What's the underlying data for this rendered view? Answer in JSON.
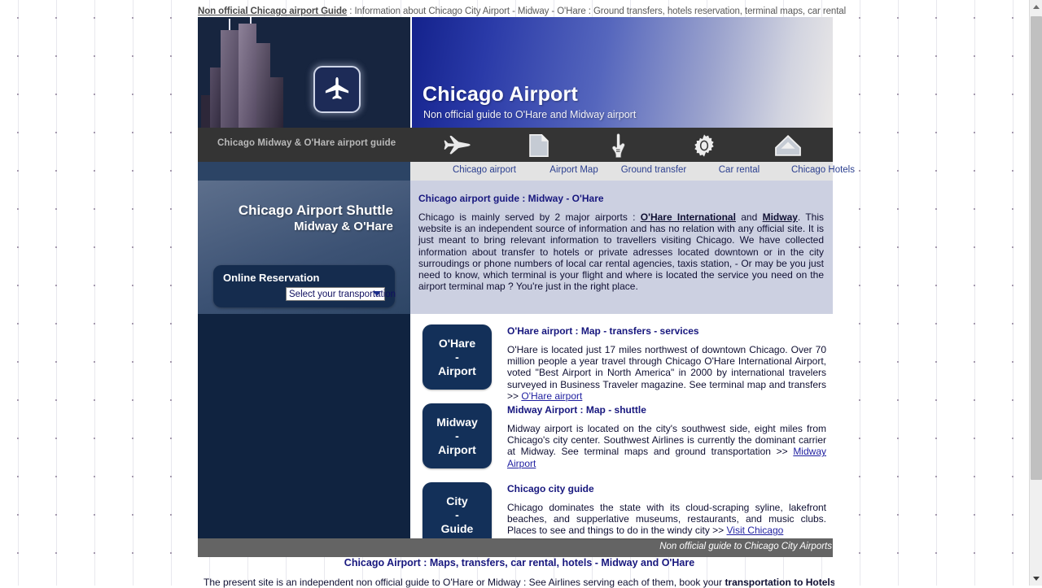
{
  "document": {
    "title_strong": "Non official Chicago airport Guide",
    "title_rest": " : Information about Chicago City Airport - Midway - O'Hare : Ground transfers, hotels reservation, terminal maps, car rental"
  },
  "banner": {
    "heading": "Chicago Airport",
    "subheading": "Non official guide to O'Hare and Midway airport",
    "photo_alt": "willis-tower-photo",
    "badge_icon": "airplane-icon"
  },
  "nav": {
    "tagline": "Chicago Midway & O'Hare airport guide",
    "items": [
      {
        "icon": "airplane-icon",
        "label": "Chicago airport"
      },
      {
        "icon": "document-icon",
        "label": "Airport Map"
      },
      {
        "icon": "pointing-hand-icon",
        "label": "Ground transfer"
      },
      {
        "icon": "gear-icon",
        "label": "Car rental"
      },
      {
        "icon": "house-icon",
        "label": "Chicago Hotels"
      }
    ]
  },
  "sidebar": {
    "heading": "Chicago Airport Shuttle",
    "subheading": "Midway & O'Hare",
    "reservation_title": "Online Reservation",
    "select_value": "Select your transportation",
    "select_options": [
      "Select your transportation"
    ]
  },
  "intro": {
    "title": "Chicago airport guide : Midway - O'Hare",
    "text_part1": "Chicago is mainly served by 2 major airports : ",
    "link1": "O'Hare International",
    "text_part2": " and ",
    "link2": "Midway",
    "text_part3": ". This website is an independent source of information and has no relation with any official site. It is just meant to bring relevant information to travellers visiting Chicago. We have collected information about transfer to hotels or private adresses located downtown or in the city surroudings or phone numbers of local car rental agencies, taxis station, - Or may be you just need to know, which terminal is your flight and where is located the service you need on the airport terminal map ? You're just in the right place."
  },
  "sections": [
    {
      "badge_line1": "O'Hare",
      "badge_line2": "-",
      "badge_line3": "Airport",
      "title": "O'Hare airport : Map - transfers - services",
      "body": "O'Hare is located just 17 miles northwest of downtown Chicago. Over 70 million people a year travel through Chicago O'Hare International Airport, voted \"Best Airport in North America\" in 2000 by international travelers surveyed in Business Traveler magazine. See terminal map and transfers >> ",
      "link": "O'Hare airport"
    },
    {
      "badge_line1": "Midway",
      "badge_line2": "-",
      "badge_line3": "Airport",
      "title": "Midway Airport : Map - shuttle",
      "body": "Midway airport is located on the city's southwest side, eight miles from Chicago's city center. Southwest Airlines is currently the dominant carrier at Midway. See terminal maps and ground transportation >> ",
      "link": "Midway Airport"
    },
    {
      "badge_line1": "City",
      "badge_line2": "-",
      "badge_line3": "Guide",
      "title": "Chicago city guide",
      "body": "Chicago dominates the state with its cloud-scraping syline, lakefront beaches, and supperlative museums, restaurants, and music clubs. Places to see and things to do in the windy city >> ",
      "link": "Visit Chicago"
    }
  ],
  "footer": {
    "bar_text": "Non official guide to Chicago City Airports",
    "below_title": "Chicago Airport : Maps, transfers, car rental, hotels - Midway and O'Hare",
    "below_text_part1": "The present site is an independent non official guide to O'Hare or Midway : See Airlines serving each of them, book your ",
    "below_text_bold": "transportation to Hotels"
  },
  "colors": {
    "navy": "#133059",
    "banner_blue": "#14228c",
    "nav_bar": "#343434",
    "intro_panel": "#ccd0e1",
    "link_blue": "#17177e",
    "footer_gray": "#646464"
  }
}
